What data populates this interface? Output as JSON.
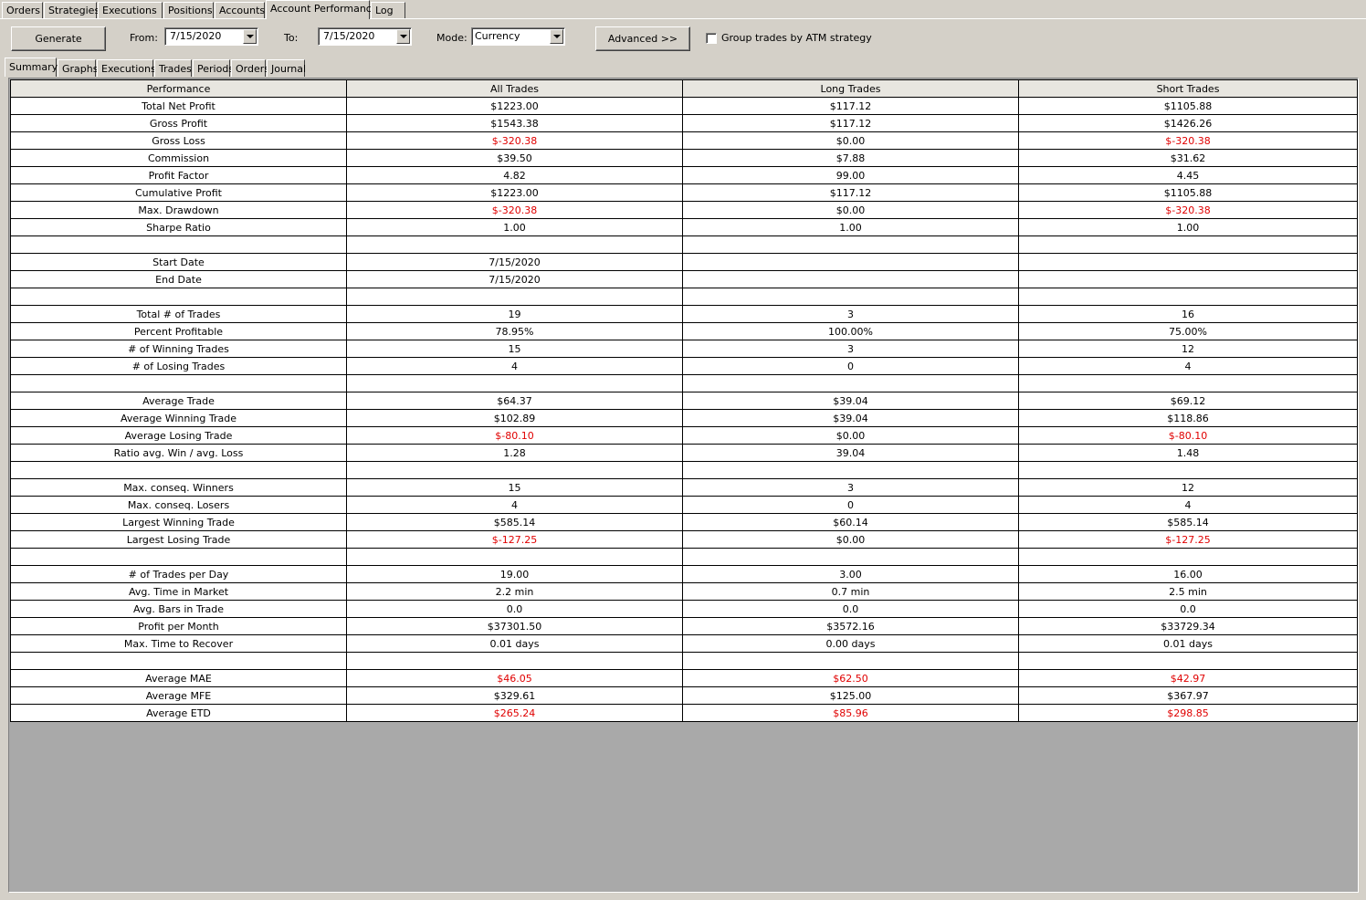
{
  "top_tabs": [
    {
      "label": "Orders"
    },
    {
      "label": "Strategies"
    },
    {
      "label": "Executions"
    },
    {
      "label": "Positions"
    },
    {
      "label": "Accounts"
    },
    {
      "label": "Account Performance",
      "active": true
    },
    {
      "label": "Log"
    }
  ],
  "toolbar": {
    "generate_label": "Generate",
    "from_label": "From:",
    "from_value": "7/15/2020",
    "to_label": "To:",
    "to_value": "7/15/2020",
    "mode_label": "Mode:",
    "mode_value": "Currency",
    "advanced_label": "Advanced >>",
    "group_checkbox_label": "Group trades by ATM strategy",
    "group_checked": false
  },
  "sub_tabs": [
    {
      "label": "Summary",
      "active": true
    },
    {
      "label": "Graphs"
    },
    {
      "label": "Executions"
    },
    {
      "label": "Trades"
    },
    {
      "label": "Periods"
    },
    {
      "label": "Orders"
    },
    {
      "label": "Journal"
    }
  ],
  "table": {
    "headers": [
      "Performance",
      "All Trades",
      "Long Trades",
      "Short Trades"
    ],
    "negative_color": "#e00000",
    "rows": [
      {
        "label": "Total Net Profit",
        "all": "$1223.00",
        "long": "$117.12",
        "short": "$1105.88",
        "neg": [
          false,
          false,
          false
        ]
      },
      {
        "label": "Gross Profit",
        "all": "$1543.38",
        "long": "$117.12",
        "short": "$1426.26",
        "neg": [
          false,
          false,
          false
        ]
      },
      {
        "label": "Gross Loss",
        "all": "$-320.38",
        "long": "$0.00",
        "short": "$-320.38",
        "neg": [
          true,
          false,
          true
        ]
      },
      {
        "label": "Commission",
        "all": "$39.50",
        "long": "$7.88",
        "short": "$31.62",
        "neg": [
          false,
          false,
          false
        ]
      },
      {
        "label": "Profit Factor",
        "all": "4.82",
        "long": "99.00",
        "short": "4.45",
        "neg": [
          false,
          false,
          false
        ]
      },
      {
        "label": "Cumulative Profit",
        "all": "$1223.00",
        "long": "$117.12",
        "short": "$1105.88",
        "neg": [
          false,
          false,
          false
        ]
      },
      {
        "label": "Max. Drawdown",
        "all": "$-320.38",
        "long": "$0.00",
        "short": "$-320.38",
        "neg": [
          true,
          false,
          true
        ]
      },
      {
        "label": "Sharpe Ratio",
        "all": "1.00",
        "long": "1.00",
        "short": "1.00",
        "neg": [
          false,
          false,
          false
        ]
      },
      {
        "label": "",
        "all": "",
        "long": "",
        "short": "",
        "neg": [
          false,
          false,
          false
        ]
      },
      {
        "label": "Start Date",
        "all": "7/15/2020",
        "long": "",
        "short": "",
        "neg": [
          false,
          false,
          false
        ]
      },
      {
        "label": "End Date",
        "all": "7/15/2020",
        "long": "",
        "short": "",
        "neg": [
          false,
          false,
          false
        ]
      },
      {
        "label": "",
        "all": "",
        "long": "",
        "short": "",
        "neg": [
          false,
          false,
          false
        ]
      },
      {
        "label": "Total # of Trades",
        "all": "19",
        "long": "3",
        "short": "16",
        "neg": [
          false,
          false,
          false
        ]
      },
      {
        "label": "Percent Profitable",
        "all": "78.95%",
        "long": "100.00%",
        "short": "75.00%",
        "neg": [
          false,
          false,
          false
        ]
      },
      {
        "label": "# of Winning Trades",
        "all": "15",
        "long": "3",
        "short": "12",
        "neg": [
          false,
          false,
          false
        ]
      },
      {
        "label": "# of Losing Trades",
        "all": "4",
        "long": "0",
        "short": "4",
        "neg": [
          false,
          false,
          false
        ]
      },
      {
        "label": "",
        "all": "",
        "long": "",
        "short": "",
        "neg": [
          false,
          false,
          false
        ]
      },
      {
        "label": "Average Trade",
        "all": "$64.37",
        "long": "$39.04",
        "short": "$69.12",
        "neg": [
          false,
          false,
          false
        ]
      },
      {
        "label": "Average Winning Trade",
        "all": "$102.89",
        "long": "$39.04",
        "short": "$118.86",
        "neg": [
          false,
          false,
          false
        ]
      },
      {
        "label": "Average Losing Trade",
        "all": "$-80.10",
        "long": "$0.00",
        "short": "$-80.10",
        "neg": [
          true,
          false,
          true
        ]
      },
      {
        "label": "Ratio avg. Win / avg. Loss",
        "all": "1.28",
        "long": "39.04",
        "short": "1.48",
        "neg": [
          false,
          false,
          false
        ]
      },
      {
        "label": "",
        "all": "",
        "long": "",
        "short": "",
        "neg": [
          false,
          false,
          false
        ]
      },
      {
        "label": "Max. conseq. Winners",
        "all": "15",
        "long": "3",
        "short": "12",
        "neg": [
          false,
          false,
          false
        ]
      },
      {
        "label": "Max. conseq. Losers",
        "all": "4",
        "long": "0",
        "short": "4",
        "neg": [
          false,
          false,
          false
        ]
      },
      {
        "label": "Largest Winning Trade",
        "all": "$585.14",
        "long": "$60.14",
        "short": "$585.14",
        "neg": [
          false,
          false,
          false
        ]
      },
      {
        "label": "Largest Losing Trade",
        "all": "$-127.25",
        "long": "$0.00",
        "short": "$-127.25",
        "neg": [
          true,
          false,
          true
        ]
      },
      {
        "label": "",
        "all": "",
        "long": "",
        "short": "",
        "neg": [
          false,
          false,
          false
        ]
      },
      {
        "label": "# of Trades per Day",
        "all": "19.00",
        "long": "3.00",
        "short": "16.00",
        "neg": [
          false,
          false,
          false
        ]
      },
      {
        "label": "Avg. Time in Market",
        "all": "2.2 min",
        "long": "0.7 min",
        "short": "2.5 min",
        "neg": [
          false,
          false,
          false
        ]
      },
      {
        "label": "Avg. Bars in Trade",
        "all": "0.0",
        "long": "0.0",
        "short": "0.0",
        "neg": [
          false,
          false,
          false
        ]
      },
      {
        "label": "Profit per Month",
        "all": "$37301.50",
        "long": "$3572.16",
        "short": "$33729.34",
        "neg": [
          false,
          false,
          false
        ]
      },
      {
        "label": "Max. Time to Recover",
        "all": "0.01 days",
        "long": "0.00 days",
        "short": "0.01 days",
        "neg": [
          false,
          false,
          false
        ]
      },
      {
        "label": "",
        "all": "",
        "long": "",
        "short": "",
        "neg": [
          false,
          false,
          false
        ]
      },
      {
        "label": "Average MAE",
        "all": "$46.05",
        "long": "$62.50",
        "short": "$42.97",
        "neg": [
          true,
          true,
          true
        ]
      },
      {
        "label": "Average MFE",
        "all": "$329.61",
        "long": "$125.00",
        "short": "$367.97",
        "neg": [
          false,
          false,
          false
        ]
      },
      {
        "label": "Average ETD",
        "all": "$265.24",
        "long": "$85.96",
        "short": "$298.85",
        "neg": [
          true,
          true,
          true
        ]
      }
    ]
  }
}
